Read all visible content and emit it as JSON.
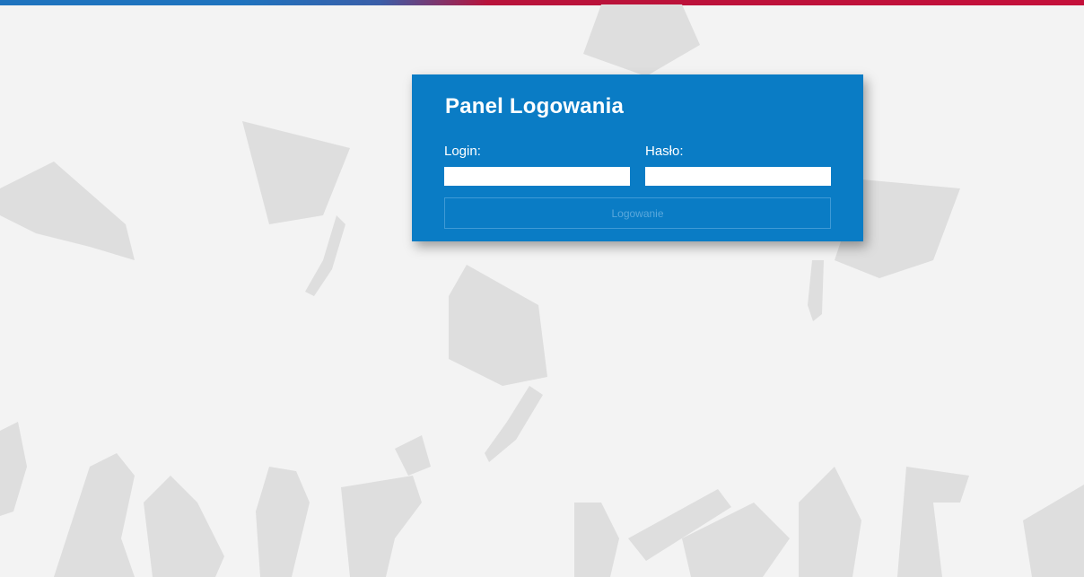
{
  "login_panel": {
    "title": "Panel Logowania",
    "login_label": "Login:",
    "login_value": "",
    "password_label": "Hasło:",
    "password_value": "",
    "submit_label": "Logowanie"
  },
  "colors": {
    "panel_bg": "#0a7cc5",
    "top_bar_blue": "#1e73be",
    "top_bar_red": "#c4103a",
    "background": "#f3f3f3",
    "silhouette": "#dedede"
  },
  "background_icons": [
    "graduation-cap-icon",
    "raised-hands-icon",
    "diploma-scroll-icon"
  ]
}
